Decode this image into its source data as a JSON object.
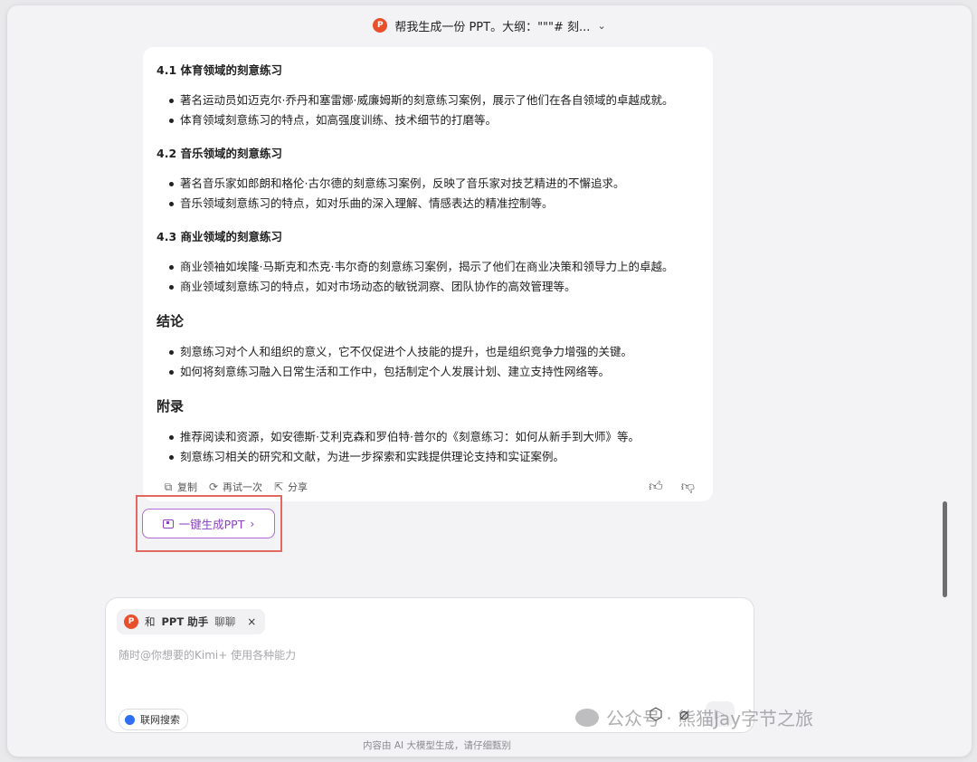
{
  "header": {
    "title": "帮我生成一份 PPT。大纲：\"\"\"# 刻...",
    "badge": "P"
  },
  "sections": [
    {
      "heading": "4.1 体育领域的刻意练习",
      "items": [
        "著名运动员如迈克尔·乔丹和塞雷娜·威廉姆斯的刻意练习案例，展示了他们在各自领域的卓越成就。",
        "体育领域刻意练习的特点，如高强度训练、技术细节的打磨等。"
      ]
    },
    {
      "heading": "4.2 音乐领域的刻意练习",
      "items": [
        "著名音乐家如郎朗和格伦·古尔德的刻意练习案例，反映了音乐家对技艺精进的不懈追求。",
        "音乐领域刻意练习的特点，如对乐曲的深入理解、情感表达的精准控制等。"
      ]
    },
    {
      "heading": "4.3 商业领域的刻意练习",
      "items": [
        "商业领袖如埃隆·马斯克和杰克·韦尔奇的刻意练习案例，揭示了他们在商业决策和领导力上的卓越。",
        "商业领域刻意练习的特点，如对市场动态的敏锐洞察、团队协作的高效管理等。"
      ]
    },
    {
      "heading": "结论",
      "items": [
        "刻意练习对个人和组织的意义，它不仅促进个人技能的提升，也是组织竞争力增强的关键。",
        "如何将刻意练习融入日常生活和工作中，包括制定个人发展计划、建立支持性网络等。"
      ]
    },
    {
      "heading": "附录",
      "items": [
        "推荐阅读和资源，如安德斯·艾利克森和罗伯特·普尔的《刻意练习：如何从新手到大师》等。",
        "刻意练习相关的研究和文献，为进一步探索和实践提供理论支持和实证案例。"
      ]
    }
  ],
  "actions": {
    "copy": "复制",
    "retry": "再试一次",
    "share": "分享"
  },
  "generate": {
    "label": "一键生成PPT",
    "arrow": "›"
  },
  "input": {
    "chip_prefix": "和",
    "chip_name": "PPT 助手",
    "chip_suffix": "聊聊",
    "chip_close": "×",
    "placeholder": "随时@你想要的Kimi+ 使用各种能力",
    "web_search": "联网搜索"
  },
  "footer": "内容由 AI 大模型生成，请仔细甄别",
  "watermark": "公众号 · 熊猫Jay字节之旅",
  "colors": {
    "accent": "#8a3fc4",
    "highlight": "#e0685e",
    "toggle": "#2f6df2",
    "badge": "#e8502b"
  }
}
